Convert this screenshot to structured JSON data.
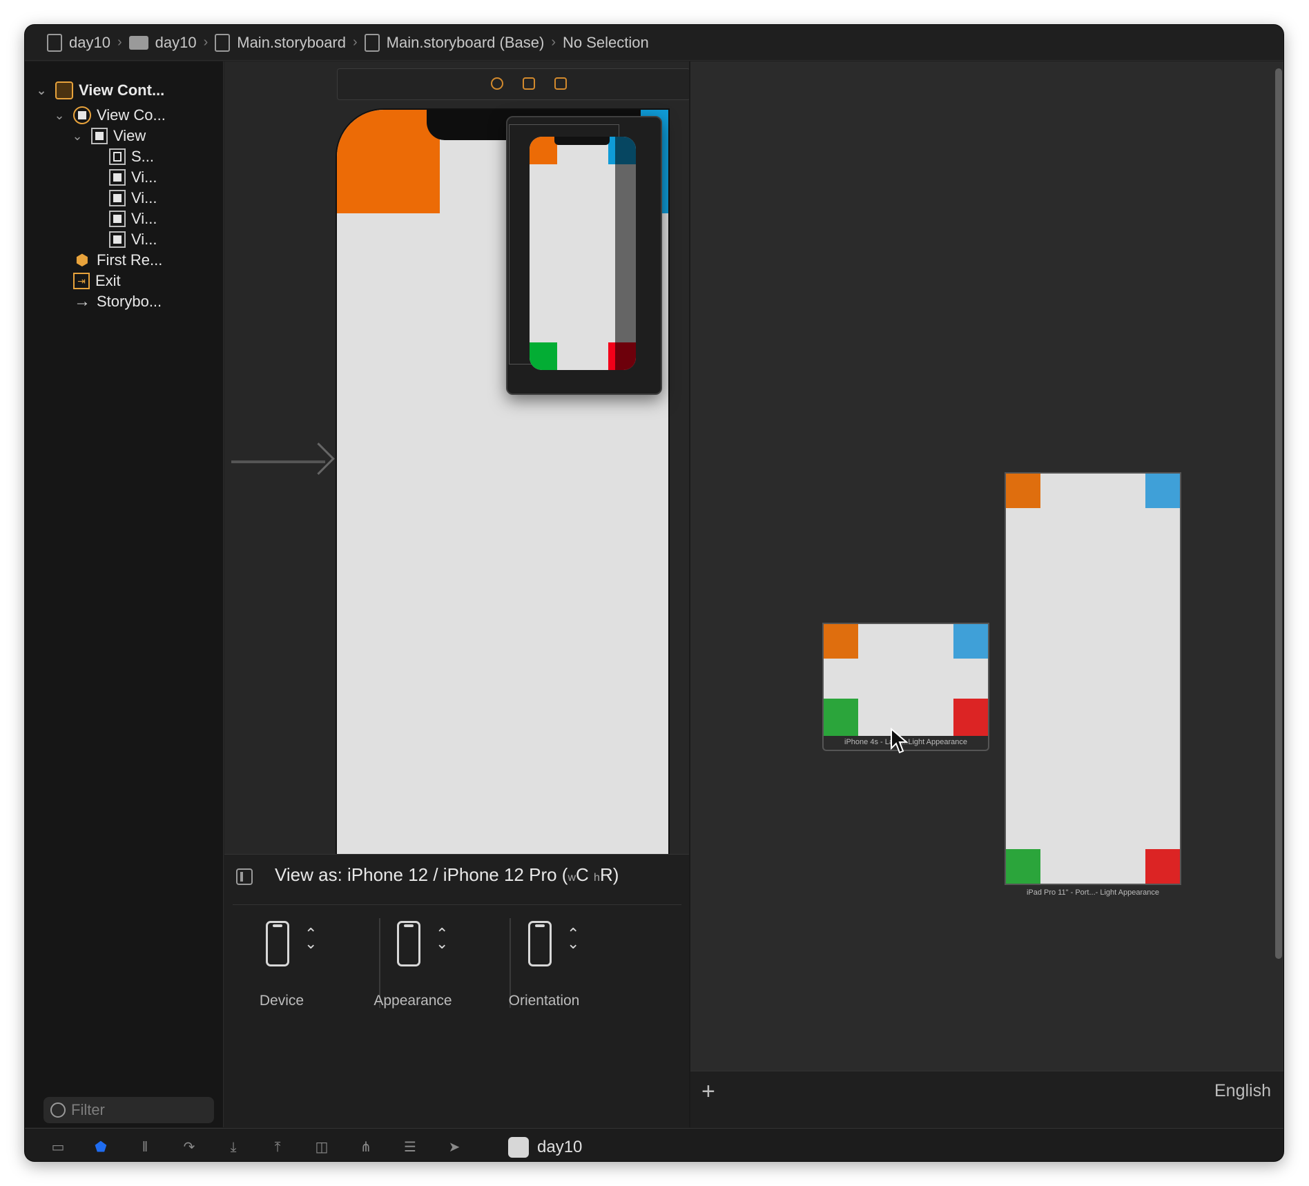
{
  "breadcrumb": {
    "items": [
      "day10",
      "day10",
      "Main.storyboard",
      "Main.storyboard (Base)",
      "No Selection"
    ],
    "separator": "›"
  },
  "outline": {
    "rows": [
      {
        "label": "View Cont...",
        "icon": "view-controller-scene-icon",
        "bold": true
      },
      {
        "label": "View Co...",
        "icon": "view-controller-icon"
      },
      {
        "label": "View",
        "icon": "view-icon"
      },
      {
        "label": "S...",
        "icon": "safe-area-icon"
      },
      {
        "label": "Vi...",
        "icon": "view-icon"
      },
      {
        "label": "Vi...",
        "icon": "view-icon"
      },
      {
        "label": "Vi...",
        "icon": "view-icon"
      },
      {
        "label": "Vi...",
        "icon": "view-icon"
      },
      {
        "label": "First Re...",
        "icon": "first-responder-icon"
      },
      {
        "label": "Exit",
        "icon": "exit-icon"
      },
      {
        "label": "Storybo...",
        "icon": "storyboard-entry-arrow-icon"
      }
    ],
    "filter_placeholder": "Filter"
  },
  "canvas": {
    "view_as_prefix": "View as: iPhone 12 / iPhone 12 Pro (",
    "size_w": "w",
    "size_w_value": "C",
    "size_h": "h",
    "size_h_value": "R)",
    "configs": [
      {
        "label": "Device",
        "icon": "device-phone-icon"
      },
      {
        "label": "Appearance",
        "icon": "appearance-phone-icon"
      },
      {
        "label": "Orientation",
        "icon": "orientation-phone-icon"
      }
    ]
  },
  "previews": {
    "landscape_caption": "iPhone 4s - Land...Light Appearance",
    "portrait_caption": "iPad Pro 11\" - Port...- Light Appearance",
    "add_label": "+",
    "language": "English"
  },
  "colors": {
    "orange": "#ec6b06",
    "blue": "#0f9bd7",
    "green": "#03ad34",
    "red": "#f20019",
    "preview_orange": "#df6e0e",
    "preview_blue": "#3fa0d8",
    "preview_green": "#2ba53b",
    "preview_red": "#dc2424"
  },
  "debug_bar": {
    "scheme": "day10"
  }
}
